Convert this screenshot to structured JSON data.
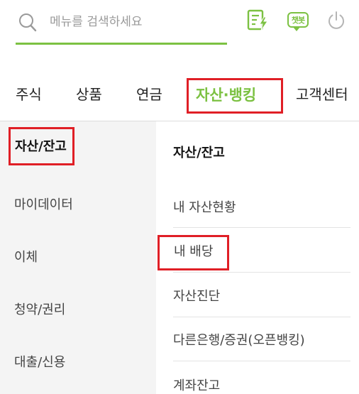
{
  "search": {
    "placeholder": "메뉴를 검색하세요"
  },
  "header": {
    "chatbot_label": "챗봇"
  },
  "nav": {
    "tabs": [
      {
        "label": "주식"
      },
      {
        "label": "상품"
      },
      {
        "label": "연금"
      },
      {
        "label": "자산·뱅킹"
      },
      {
        "label": "고객센터"
      }
    ]
  },
  "sidebar": {
    "items": [
      {
        "label": "자산/잔고"
      },
      {
        "label": "마이데이터"
      },
      {
        "label": "이체"
      },
      {
        "label": "청약/권리"
      },
      {
        "label": "대출/신용"
      }
    ]
  },
  "submenu": {
    "header": "자산/잔고",
    "items": [
      {
        "label": "내 자산현황"
      },
      {
        "label": "내 배당"
      },
      {
        "label": "자산진단"
      },
      {
        "label": "다른은행/증권(오픈뱅킹)"
      },
      {
        "label": "계좌잔고"
      }
    ]
  },
  "colors": {
    "accent": "#7cc142",
    "highlight_box": "#e01f26",
    "sidebar_bg": "#f4f4f4"
  }
}
